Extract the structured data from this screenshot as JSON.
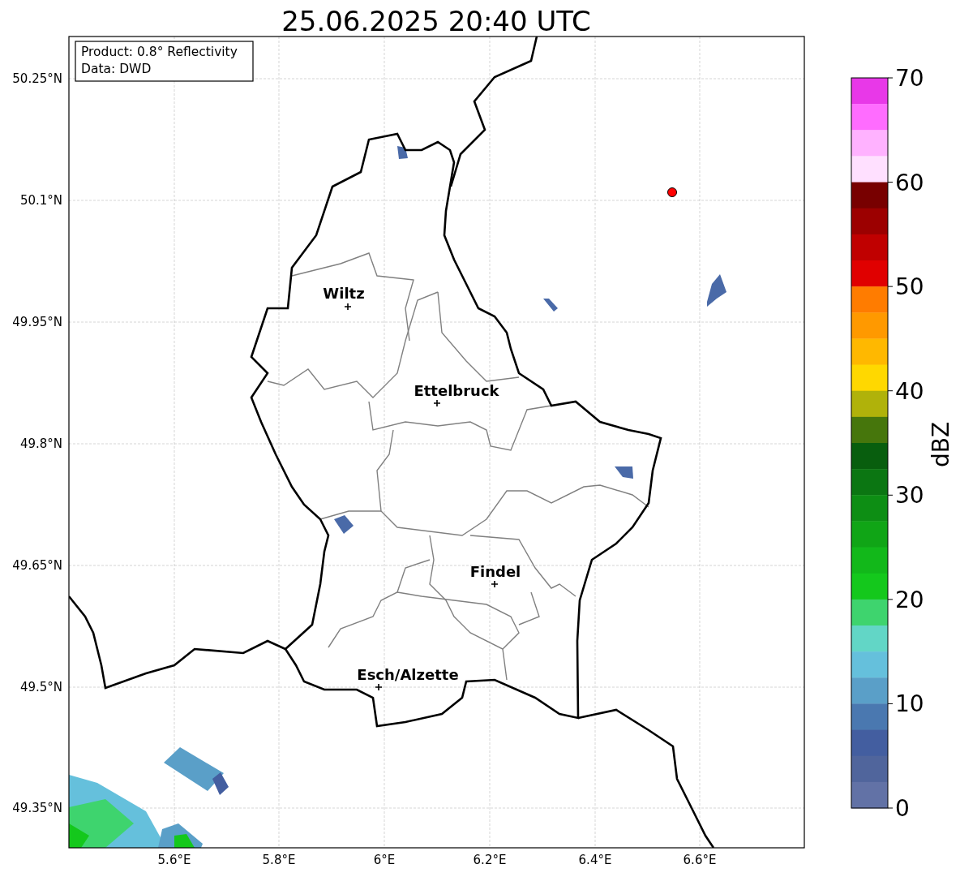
{
  "title": "25.06.2025 20:40 UTC",
  "info_box": [
    "Product: 0.8° Reflectivity",
    "Data: DWD"
  ],
  "x_ticks": [
    "5.6°E",
    "5.8°E",
    "6°E",
    "6.2°E",
    "6.4°E",
    "6.6°E"
  ],
  "y_ticks": [
    "50.25°N",
    "50.1°N",
    "49.95°N",
    "49.8°N",
    "49.65°N",
    "49.5°N",
    "49.35°N"
  ],
  "cities": [
    "Wiltz",
    "Ettelbruck",
    "Findel",
    "Esch/Alzette"
  ],
  "colorbar": {
    "label": "dBZ",
    "ticks": [
      "70",
      "60",
      "50",
      "40",
      "30",
      "20",
      "10",
      "0"
    ],
    "segments": [
      {
        "color": "#e838e8"
      },
      {
        "color": "#ff6cff"
      },
      {
        "color": "#ffb2ff"
      },
      {
        "color": "#ffe0ff"
      },
      {
        "color": "#780000"
      },
      {
        "color": "#9c0000"
      },
      {
        "color": "#c00000"
      },
      {
        "color": "#e00000"
      },
      {
        "color": "#ff7c00"
      },
      {
        "color": "#ff9900"
      },
      {
        "color": "#ffb800"
      },
      {
        "color": "#ffd800"
      },
      {
        "color": "#b0b20a"
      },
      {
        "color": "#46760c"
      },
      {
        "color": "#085e0e"
      },
      {
        "color": "#0b7612"
      },
      {
        "color": "#0d8e14"
      },
      {
        "color": "#10a516"
      },
      {
        "color": "#12b81a"
      },
      {
        "color": "#14c81c"
      },
      {
        "color": "#3ed46e"
      },
      {
        "color": "#62d6c6"
      },
      {
        "color": "#65c0dc"
      },
      {
        "color": "#5a9fc8"
      },
      {
        "color": "#4a78b0"
      },
      {
        "color": "#435ea0"
      },
      {
        "color": "#50659c"
      },
      {
        "color": "#6272a6"
      }
    ]
  }
}
